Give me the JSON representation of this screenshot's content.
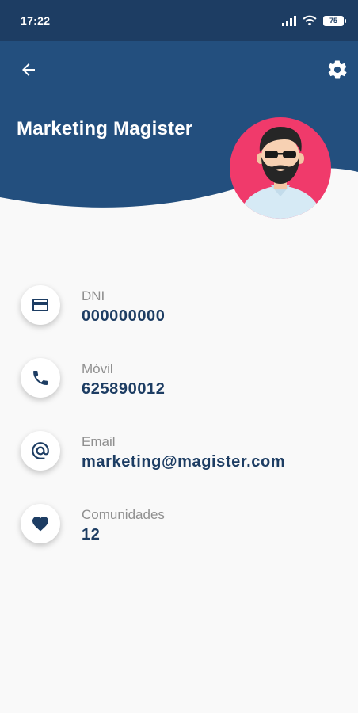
{
  "status_bar": {
    "time": "17:22",
    "battery": "75",
    "icons": [
      "signal-icon",
      "wifi-icon",
      "battery-icon"
    ]
  },
  "header": {
    "back_icon": "arrow-left-icon",
    "settings_icon": "gear-icon",
    "name": "Marketing Magister",
    "avatar": "avatar-man-beard-sunglasses"
  },
  "fields": [
    {
      "icon": "credit-card-icon",
      "label": "DNI",
      "value": "000000000"
    },
    {
      "icon": "phone-icon",
      "label": "Móvil",
      "value": "625890012"
    },
    {
      "icon": "at-icon",
      "label": "Email",
      "value": "marketing@magister.com"
    },
    {
      "icon": "heart-icon",
      "label": "Comunidades",
      "value": "12"
    }
  ],
  "colors": {
    "primary": "#1d3d63",
    "header": "#234f7e",
    "avatar_bg": "#f03a6b",
    "background": "#f9f9f9",
    "label": "#8f8f8f"
  }
}
